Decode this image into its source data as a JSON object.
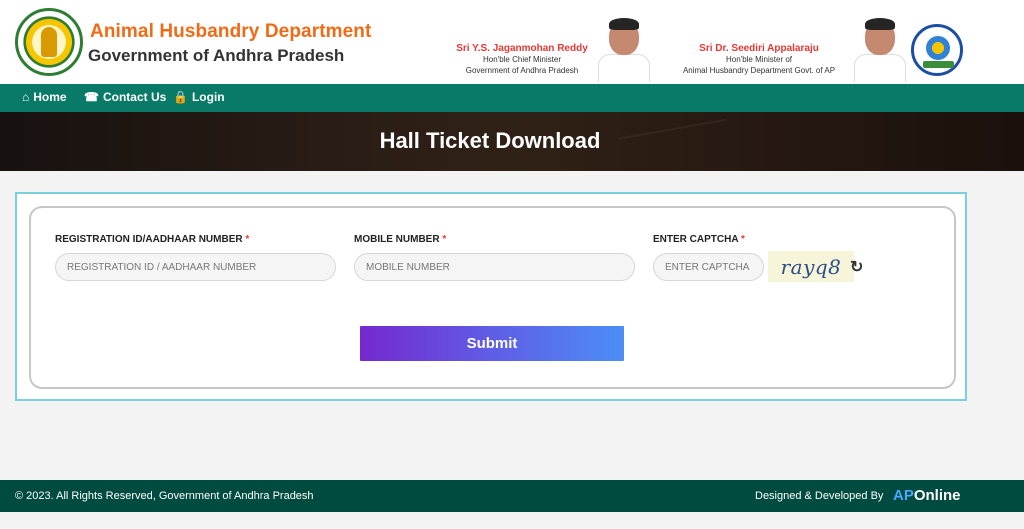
{
  "header": {
    "department": "Animal Husbandry Department",
    "government": "Government of Andhra Pradesh",
    "minister_one": {
      "name": "Sri Y.S. Jaganmohan Reddy",
      "role": "Hon'ble Chief Minister",
      "organization": "Government of Andhra Pradesh"
    },
    "minister_two": {
      "name": "Sri Dr. Seediri Appalaraju",
      "role": "Hon'ble Minister of",
      "organization": "Animal Husbandry Department Govt. of AP"
    }
  },
  "nav": {
    "home": "Home",
    "contact": "Contact Us",
    "login": "Login"
  },
  "page": {
    "title": "Hall Ticket Download"
  },
  "form": {
    "registration": {
      "label": "REGISTRATION ID/AADHAAR NUMBER",
      "required_mark": "*",
      "placeholder": "REGISTRATION ID / AADHAAR NUMBER"
    },
    "mobile": {
      "label": "MOBILE NUMBER",
      "required_mark": "*",
      "placeholder": "MOBILE NUMBER"
    },
    "captcha": {
      "label": "ENTER CAPTCHA",
      "required_mark": "*",
      "placeholder": "ENTER CAPTCHA",
      "code": "rayq8"
    },
    "submit_label": "Submit"
  },
  "footer": {
    "copyright": "© 2023. All Rights Reserved, Government of Andhra Pradesh",
    "designed": "Designed & Developed By",
    "brand_ap": "AP",
    "brand_online": "Online"
  },
  "colors": {
    "orange": "#f06b16",
    "green": "#087a67",
    "footer": "#004b3f",
    "button_start": "#7529cf",
    "button_end": "#4d8ef6"
  }
}
